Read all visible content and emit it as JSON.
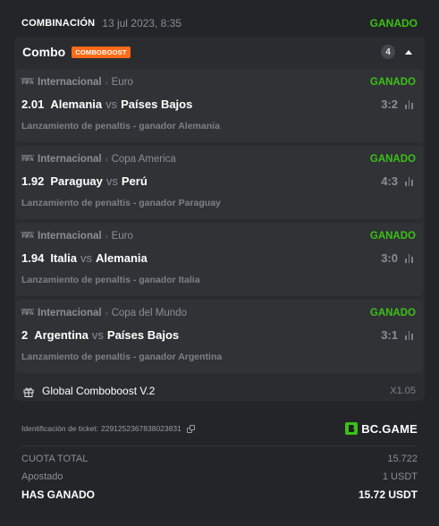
{
  "header": {
    "title": "COMBINACIÓN",
    "date": "13 jul 2023, 8:35",
    "status": "GANADO"
  },
  "combo": {
    "label": "Combo",
    "badge": "COMBOBOOST",
    "count": "4"
  },
  "matches": [
    {
      "logo_small": "FRIENDLY",
      "logo_big": "FIFA",
      "league": "Internacional",
      "separator": "›",
      "tournament": "Euro",
      "status": "GANADO",
      "odds": "2.01",
      "team1": "Alemania",
      "vs": "vs",
      "team2": "Países Bajos",
      "score": "3:2",
      "selection": "Lanzamiento de penaltis - ganador Alemania"
    },
    {
      "logo_small": "FRIENDLY",
      "logo_big": "FIFA",
      "league": "Internacional",
      "separator": "›",
      "tournament": "Copa America",
      "status": "GANADO",
      "odds": "1.92",
      "team1": "Paraguay",
      "vs": "vs",
      "team2": "Perú",
      "score": "4:3",
      "selection": "Lanzamiento de penaltis - ganador Paraguay"
    },
    {
      "logo_small": "FRIENDLY",
      "logo_big": "FIFA",
      "league": "Internacional",
      "separator": "›",
      "tournament": "Euro",
      "status": "GANADO",
      "odds": "1.94",
      "team1": "Italia",
      "vs": "vs",
      "team2": "Alemania",
      "score": "3:0",
      "selection": "Lanzamiento de penaltis - ganador Italia"
    },
    {
      "logo_small": "FRIENDLY",
      "logo_big": "FIFA",
      "league": "Internacional",
      "separator": "›",
      "tournament": "Copa del Mundo",
      "status": "GANADO",
      "odds": "2",
      "team1": "Argentina",
      "vs": "vs",
      "team2": "Países Bajos",
      "score": "3:1",
      "selection": "Lanzamiento de penaltis - ganador Argentina"
    }
  ],
  "global_boost": {
    "icon": "gift-icon",
    "label": "Global Comboboost V.2",
    "multiplier": "X1.05"
  },
  "ticket": {
    "label": "Identificación de ticket:",
    "id": "2291252367838023831",
    "brand": "BC.GAME"
  },
  "summary": {
    "total_odds_label": "CUOTA TOTAL",
    "total_odds_value": "15.722",
    "stake_label": "Apostado",
    "stake_value": "1 USDT",
    "won_label": "HAS GANADO",
    "won_value": "15.72 USDT"
  },
  "colors": {
    "background": "#232528",
    "card": "#2a2c30",
    "match_card": "#303236",
    "win_green": "#3bc117",
    "boost_orange": "#ff6b18",
    "muted_text": "#8b8e95"
  }
}
